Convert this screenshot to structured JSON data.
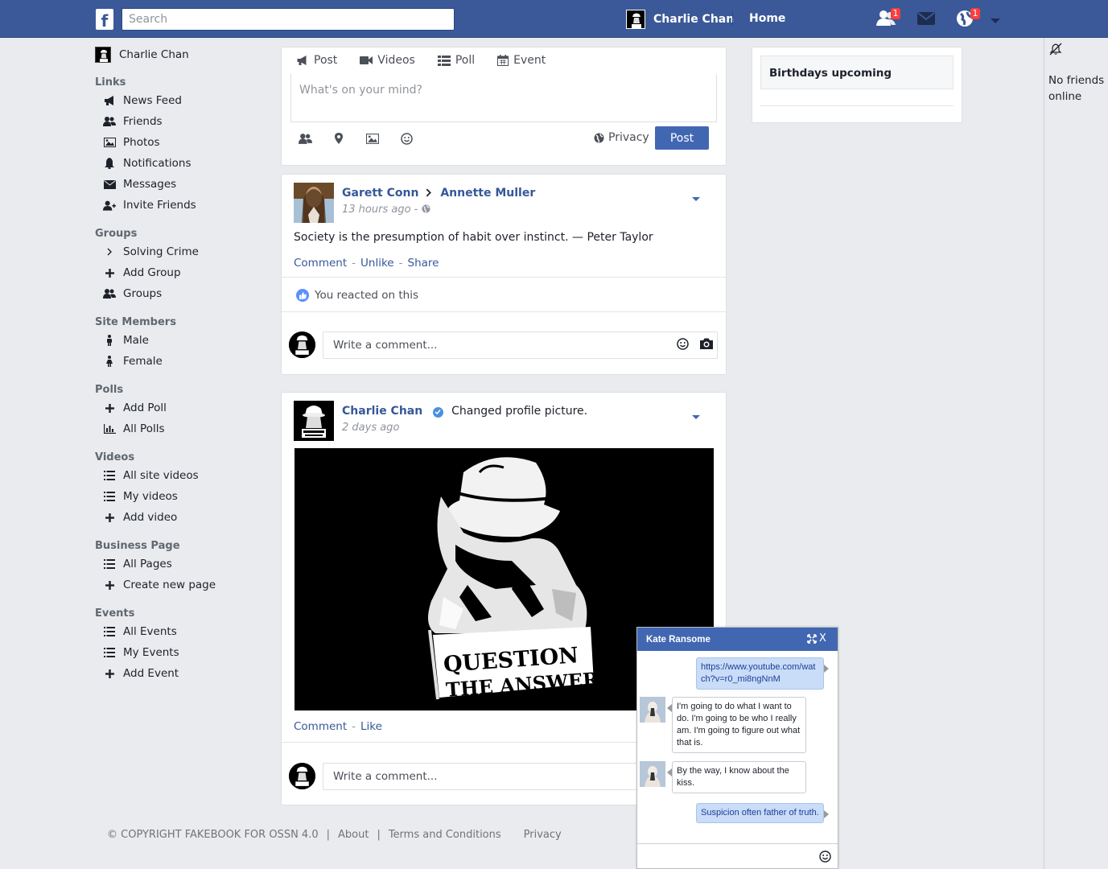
{
  "topbar": {
    "logo": "f",
    "search_placeholder": "Search",
    "user_name": "Charlie Chan",
    "home_label": "Home",
    "friend_requests_badge": "1",
    "notifications_badge": "1"
  },
  "sidebar": {
    "user_name": "Charlie Chan",
    "sections": {
      "links": {
        "title": "Links",
        "items": [
          "News Feed",
          "Friends",
          "Photos",
          "Notifications",
          "Messages",
          "Invite Friends"
        ]
      },
      "groups": {
        "title": "Groups",
        "items": [
          "Solving Crime",
          "Add Group",
          "Groups"
        ]
      },
      "members": {
        "title": "Site Members",
        "items": [
          "Male",
          "Female"
        ]
      },
      "polls": {
        "title": "Polls",
        "items": [
          "Add Poll",
          "All Polls"
        ]
      },
      "videos": {
        "title": "Videos",
        "items": [
          "All site videos",
          "My videos",
          "Add video"
        ]
      },
      "business": {
        "title": "Business Page",
        "items": [
          "All Pages",
          "Create new page"
        ]
      },
      "events": {
        "title": "Events",
        "items": [
          "All Events",
          "My Events",
          "Add Event"
        ]
      }
    }
  },
  "composer": {
    "tabs": [
      "Post",
      "Videos",
      "Poll",
      "Event"
    ],
    "placeholder": "What's on your mind?",
    "privacy_label": "Privacy",
    "post_label": "Post"
  },
  "post1": {
    "author": "Garett Conn",
    "target": "Annette Muller",
    "time": "13 hours ago",
    "time_sep": "-",
    "text": "Society is the presumption of habit over instinct. — Peter Taylor",
    "actions": [
      "Comment",
      "Unlike",
      "Share"
    ],
    "reaction_text": "You reacted on this",
    "comment_placeholder": "Write a comment..."
  },
  "post2": {
    "author": "Charlie Chan",
    "activity": "Changed profile picture.",
    "time": "2 days ago",
    "image_text_line1": "QUESTION",
    "image_text_line2": "THE ANSWER",
    "actions": [
      "Comment",
      "Like"
    ],
    "comment_placeholder": "Write a comment..."
  },
  "right": {
    "birthdays_title": "Birthdays upcoming",
    "no_friends": "No friends online"
  },
  "footer": {
    "copyright": "© COPYRIGHT FAKEBOOK FOR OSSN 4.0",
    "sep": "|",
    "links": [
      "About",
      "Terms and Conditions",
      "Privacy"
    ]
  },
  "chat": {
    "title": "Kate Ransome",
    "close": "X",
    "messages": [
      "https://www.youtube.com/watch?v=r0_mi8ngNnM",
      "I'm going to do what I want to do. I'm going to be who I really am. I'm going to figure out what that is.",
      "By the way, I know about the kiss.",
      "Suspicion often father of truth."
    ]
  },
  "colors": {
    "brand": "#3b5998",
    "link": "#365899",
    "button": "#4267b2",
    "badge": "#fa3e3e"
  }
}
